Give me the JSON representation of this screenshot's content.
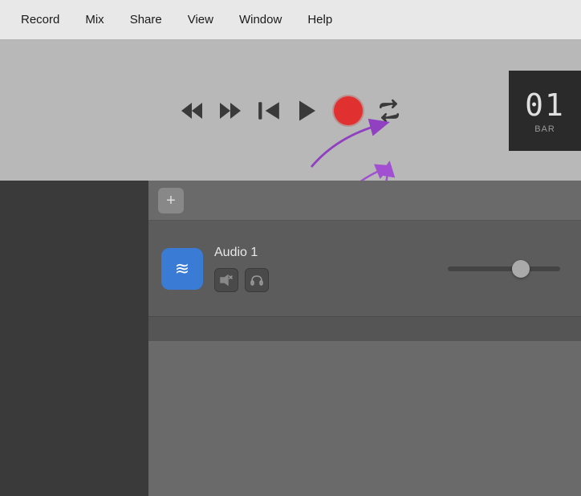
{
  "menubar": {
    "items": [
      {
        "label": "Record",
        "id": "record"
      },
      {
        "label": "Mix",
        "id": "mix"
      },
      {
        "label": "Share",
        "id": "share"
      },
      {
        "label": "View",
        "id": "view"
      },
      {
        "label": "Window",
        "id": "window"
      },
      {
        "label": "Help",
        "id": "help"
      }
    ]
  },
  "toolbar": {
    "counter": {
      "value": "01",
      "unit": "BAR"
    },
    "add_button_label": "+",
    "transport": {
      "rewind_label": "rewind",
      "fastforward_label": "fast-forward",
      "skip_label": "skip-to-beginning",
      "play_label": "play",
      "record_label": "record",
      "loop_label": "loop"
    }
  },
  "tracks": [
    {
      "name": "Audio 1",
      "icon": "audio-waveform",
      "controls": [
        {
          "id": "mute",
          "symbol": "🔇"
        },
        {
          "id": "headphones",
          "symbol": "🎧"
        }
      ]
    }
  ]
}
